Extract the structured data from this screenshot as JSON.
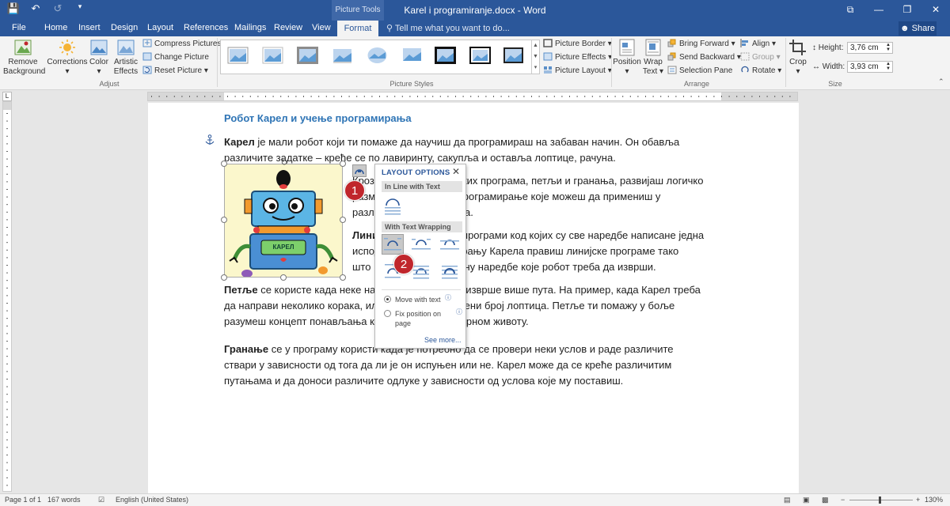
{
  "window": {
    "title": "Karel i programiranje.docx - Word",
    "context_tab": "Picture Tools",
    "controls": [
      "⧉",
      "—",
      "❐",
      "✕"
    ]
  },
  "tabs": [
    "File",
    "Home",
    "Insert",
    "Design",
    "Layout",
    "References",
    "Mailings",
    "Review",
    "View",
    "Format"
  ],
  "active_tab": "Format",
  "tell_me": "Tell me what you want to do...",
  "share": "Share",
  "ribbon": {
    "adjust": {
      "remove_background": [
        "Remove",
        "Background"
      ],
      "corrections": "Corrections",
      "color": "Color",
      "artistic_effects": [
        "Artistic",
        "Effects"
      ],
      "compress_pictures": "Compress Pictures",
      "change_picture": "Change Picture",
      "reset_picture": "Reset Picture",
      "group_label": "Adjust"
    },
    "picture_styles": {
      "picture_border": "Picture Border",
      "picture_effects": "Picture Effects",
      "picture_layout": "Picture Layout",
      "group_label": "Picture Styles"
    },
    "arrange": {
      "position": "Position",
      "wrap_text": [
        "Wrap",
        "Text"
      ],
      "bring_forward": "Bring Forward",
      "send_backward": "Send Backward",
      "selection_pane": "Selection Pane",
      "align": "Align",
      "group": "Group",
      "rotate": "Rotate",
      "group_label": "Arrange"
    },
    "size": {
      "crop": "Crop",
      "height_label": "Height:",
      "height_value": "3,76 cm",
      "width_label": "Width:",
      "width_value": "3,93 cm",
      "group_label": "Size"
    }
  },
  "document": {
    "heading": "Робот Карел и учење програмирања",
    "p1": [
      {
        "bold": "Карел",
        "text": " је мали робот који ти помаже да научиш да програмираш на забаван начин. Он обавља"
      },
      {
        "text": "различите задатке – креће се по лавиринту, сакупља и оставља лоптице, рачуна."
      }
    ],
    "p2": [
      {
        "text": "Кроз прављење линијских програма, петљи и гранања, развијаш логичко"
      },
      {
        "text": "размишљање и учиш програмирање које можеш да примениш у"
      },
      {
        "text": "различитим ситуацијама."
      }
    ],
    "p3": [
      {
        "bold": "Линијски",
        "text": " програми су програми код којих су све наредбе написане једна"
      },
      {
        "text": "испод друге. Програмирању Карела правиш линијске програме тако"
      },
      {
        "text": "што нижеш једну по једну наредбе које робот треба да изврши."
      }
    ],
    "p4": [
      {
        "bold": "Петље",
        "text": " се користе када неке наредбе треба да се изврше више пута. На пример, када Карел треба"
      },
      {
        "text": "да направи неколико корака, или да покупи одређени број лоптица. Петље ти помажу у боље"
      },
      {
        "text": "разумеш концепт понављања који постоји и у стварном животу."
      }
    ],
    "p5": [
      {
        "bold": "Гранање",
        "text": " се у програму користи када је потребно да се провери неки услов и раде различите"
      },
      {
        "text": "ствари у зависности од тога да ли је он испуњен или не. Карел може да се креће различитим"
      },
      {
        "text": "путањама и да доноси различите одлуке у зависности од услова које му поставиш."
      }
    ],
    "robot_label": "КАРЕЛ"
  },
  "layout_options": {
    "title": "LAYOUT OPTIONS",
    "inline_section": "In Line with Text",
    "wrapping_section": "With Text Wrapping",
    "move_with_text": "Move with text",
    "fix_position": [
      "Fix position on",
      "page"
    ],
    "see_more": "See more..."
  },
  "callouts": [
    "1",
    "2"
  ],
  "status": {
    "page": "Page 1 of 1",
    "words": "167 words",
    "language": "English (United States)",
    "zoom": "130%",
    "zoom_level_percent": 130
  },
  "colors": {
    "accent": "#2b579a",
    "heading": "#2e74b5",
    "callout": "#c0262c"
  }
}
